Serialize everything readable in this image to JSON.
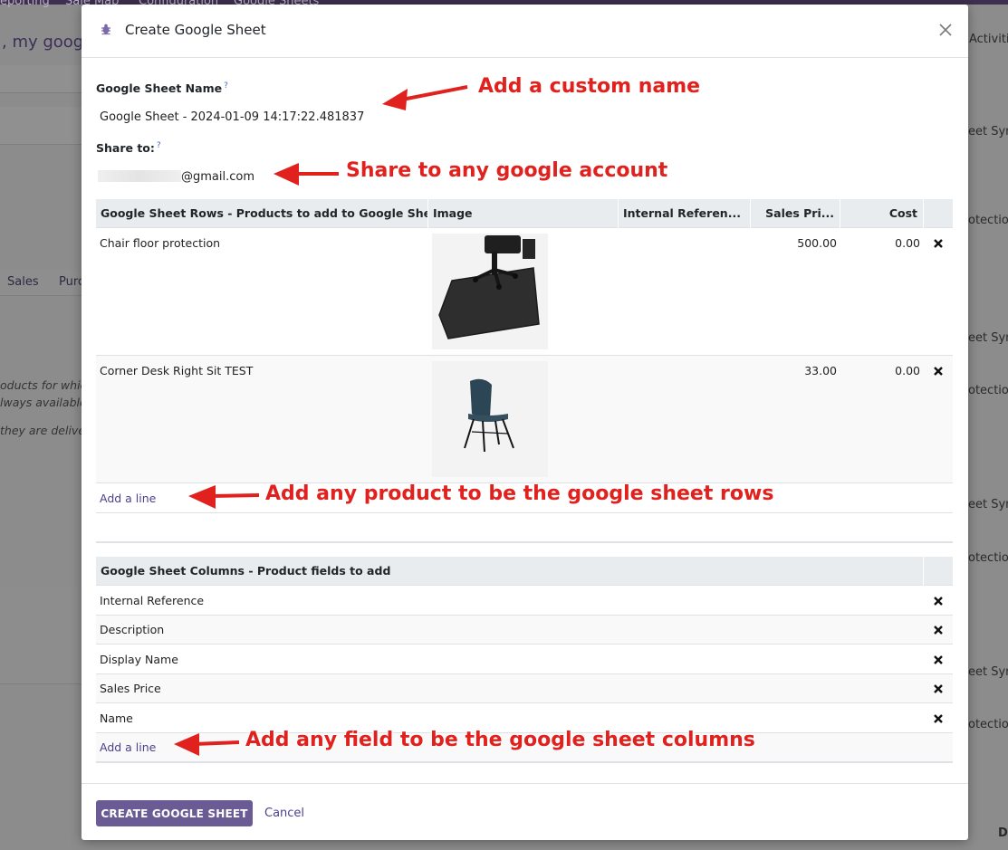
{
  "background": {
    "nav_items": [
      "eporting",
      "Sale Map",
      "Configuration",
      "Google Sheets"
    ],
    "page_title": ", my google",
    "activities_label": "Activiti",
    "tabs": [
      "Sales",
      "Purc"
    ],
    "italic_lines": [
      "oducts for whic",
      "lways available",
      "they are deliver"
    ],
    "right_texts": [
      "eet Sync",
      "otection",
      "eet Sync",
      "otection",
      "eet Sync",
      "otection",
      "eet Sync",
      "otection"
    ],
    "corner_text": "D"
  },
  "modal": {
    "title": "Create Google Sheet",
    "close_icon": "close-icon",
    "name_label": "Google Sheet Name",
    "name_help": "?",
    "name_value": "Google Sheet - 2024-01-09 14:17:22.481837",
    "share_label": "Share to:",
    "share_help": "?",
    "share_value_suffix": "@gmail.com",
    "rows_table": {
      "headers": [
        "Google Sheet Rows - Products to add to Google Sheet",
        "Image",
        "Internal Referen...",
        "Sales Pri...",
        "Cost"
      ],
      "rows": [
        {
          "name": "Chair floor protection",
          "internal_ref": "",
          "sales_price": "500.00",
          "cost": "0.00",
          "image": "chair-mat-image"
        },
        {
          "name": "Corner Desk Right Sit TEST",
          "internal_ref": "",
          "sales_price": "33.00",
          "cost": "0.00",
          "image": "chair-image"
        }
      ],
      "add_line": "Add a line"
    },
    "columns_table": {
      "header": "Google Sheet Columns - Product fields to add",
      "rows": [
        "Internal Reference",
        "Description",
        "Display Name",
        "Sales Price",
        "Name"
      ],
      "add_line": "Add a line"
    },
    "footer": {
      "create_button": "CREATE GOOGLE SHEET",
      "cancel_button": "Cancel"
    }
  },
  "annotations": {
    "name": "Add a custom name",
    "share": "Share to any google account",
    "rows": "Add any product to be the google sheet rows",
    "columns": "Add any field to be the google sheet columns",
    "color": "#e0211d"
  }
}
